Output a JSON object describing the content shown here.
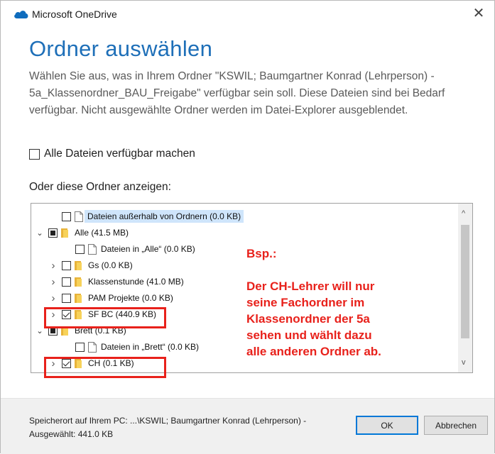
{
  "window": {
    "app_title": "Microsoft OneDrive",
    "close_glyph": "✕",
    "accent_color": "#1e6fb8"
  },
  "dialog": {
    "heading": "Ordner auswählen",
    "description": "Wählen Sie aus, was in Ihrem Ordner \"KSWIL; Baumgartner Konrad (Lehrperson) - 5a_Klassenordner_BAU_Freigabe\" verfügbar sein soll. Diese Dateien sind bei Bedarf verfügbar. Nicht ausgewählte Ordner werden im Datei-Explorer ausgeblendet.",
    "all_files_label": "Alle Dateien verfügbar machen",
    "folders_label": "Oder diese Ordner anzeigen:"
  },
  "tree": {
    "rows": [
      {
        "label": "Dateien außerhalb von Ordnern  (0.0 KB)",
        "indent": 1,
        "expander": "none",
        "check": "unchecked",
        "icon": "file-icon",
        "selected": true
      },
      {
        "label": "Alle  (41.5 MB)",
        "indent": 0,
        "expander": "expanded",
        "check": "partial",
        "icon": "folder-icon",
        "selected": false
      },
      {
        "label": "Dateien in „Alle“  (0.0 KB)",
        "indent": 2,
        "expander": "none",
        "check": "unchecked",
        "icon": "file-icon",
        "selected": false
      },
      {
        "label": "Gs  (0.0 KB)",
        "indent": 1,
        "expander": "collapsed",
        "check": "unchecked",
        "icon": "folder-icon",
        "selected": false
      },
      {
        "label": "Klassenstunde  (41.0 MB)",
        "indent": 1,
        "expander": "collapsed",
        "check": "unchecked",
        "icon": "folder-icon",
        "selected": false
      },
      {
        "label": "PAM Projekte  (0.0 KB)",
        "indent": 1,
        "expander": "collapsed",
        "check": "unchecked",
        "icon": "folder-icon",
        "selected": false
      },
      {
        "label": "SF BC  (440.9 KB)",
        "indent": 1,
        "expander": "collapsed",
        "check": "checked",
        "icon": "folder-icon",
        "selected": false
      },
      {
        "label": "Brett  (0.1 KB)",
        "indent": 0,
        "expander": "expanded",
        "check": "partial",
        "icon": "folder-icon",
        "selected": false
      },
      {
        "label": "Dateien in „Brett“  (0.0 KB)",
        "indent": 2,
        "expander": "none",
        "check": "unchecked",
        "icon": "file-icon",
        "selected": false
      },
      {
        "label": "CH  (0.1 KB)",
        "indent": 1,
        "expander": "collapsed",
        "check": "checked",
        "icon": "folder-icon",
        "selected": false
      }
    ],
    "scroll_up_glyph": "^",
    "scroll_down_glyph": "v"
  },
  "annotation": {
    "title": "Bsp.:",
    "lines": [
      "Der CH-Lehrer will nur",
      "seine Fachordner im",
      "Klassenordner der 5a",
      "sehen und wählt dazu",
      "alle anderen Ordner ab."
    ],
    "color": "#e8211b"
  },
  "footer": {
    "location_text": "Speicherort auf Ihrem PC:  ...\\KSWIL; Baumgartner Konrad (Lehrperson) -",
    "selected_text": "Ausgewählt: 441.0 KB",
    "ok_label": "OK",
    "cancel_label": "Abbrechen"
  }
}
